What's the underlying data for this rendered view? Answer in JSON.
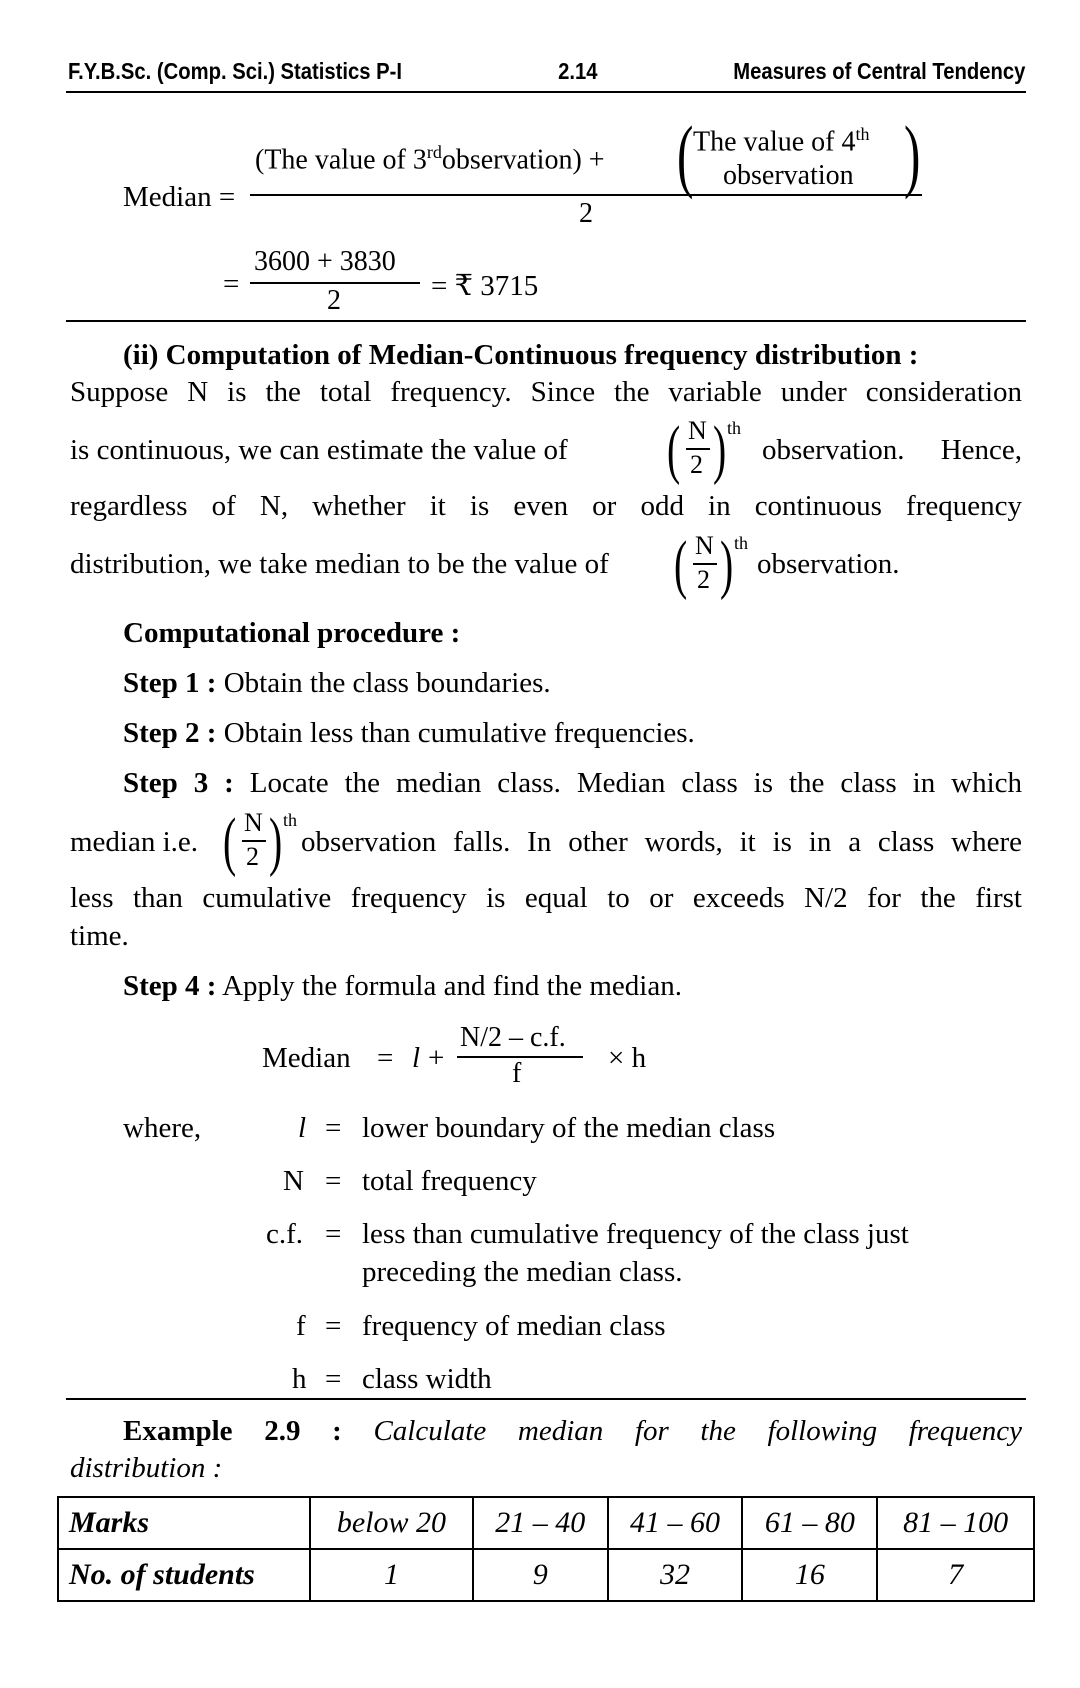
{
  "header": {
    "left": "F.Y.B.Sc. (Comp. Sci.) Statistics P-I",
    "center": "2.14",
    "right": "Measures of Central Tendency"
  },
  "median_formula": {
    "label": "Median =",
    "numerator_left": "(The value of 3",
    "numerator_sup": "rd",
    "numerator_left_end": "observation) +",
    "paren_top": "The value of 4",
    "paren_top_sup": "th",
    "paren_bottom": "observation",
    "denominator": "2",
    "eq2_sign": "=",
    "eq2_numerator": "3600 + 3830",
    "eq2_denominator": "2",
    "eq2_result": "= ₹ 3715"
  },
  "section": {
    "heading": "(ii) Computation of Median-Continuous frequency distribution :",
    "line1": "Suppose N is the total frequency. Since the variable under consideration",
    "line2a": "is continuous, we can estimate the value of",
    "line2b": "observation. Hence,",
    "line3": "regardless of N, whether it is even or odd in continuous frequency",
    "line4a": "distribution, we take median to be the value of",
    "line4b": "observation.",
    "frac_num": "N",
    "frac_den": "2",
    "frac_sup": "th"
  },
  "procedure": {
    "heading": "Computational procedure :",
    "step1_label": "Step 1 :",
    "step1_text": "Obtain the class boundaries.",
    "step2_label": "Step 2 :",
    "step2_text": "Obtain less than cumulative frequencies.",
    "step3_label": "Step 3 :",
    "step3_text": "Locate the median class. Median class is the class in which",
    "step3_line2a": "median i.e.",
    "step3_line2b": "observation falls. In other words, it is in a class where",
    "step3_line3": "less than cumulative frequency is equal to or exceeds N/2 for the first",
    "step3_line4": "time.",
    "step4_label": "Step 4 :",
    "step4_text": "Apply the formula and find the median."
  },
  "formula2": {
    "label": "Median",
    "eq": "=",
    "l": "l",
    "plus": "+",
    "numerator": "N/2 – c.f.",
    "denominator": "f",
    "times": "× h"
  },
  "where": {
    "label": "where,",
    "items": [
      {
        "sym": "l",
        "eq": "=",
        "desc": "lower boundary of the median class"
      },
      {
        "sym": "N",
        "eq": "=",
        "desc": "total frequency"
      },
      {
        "sym": "c.f.",
        "eq": "=",
        "desc": "less than cumulative frequency of the class just",
        "desc2": "preceding the median class."
      },
      {
        "sym": "f",
        "eq": "=",
        "desc": "frequency of median class"
      },
      {
        "sym": "h",
        "eq": "=",
        "desc": "class width"
      }
    ]
  },
  "example": {
    "label": "Example 2.9 :",
    "text": "Calculate median for the following frequency",
    "text2": "distribution :",
    "table": {
      "row1": [
        "Marks",
        "below 20",
        "21 – 40",
        "41 – 60",
        "61 – 80",
        "81 – 100"
      ],
      "row2": [
        "No. of students",
        "1",
        "9",
        "32",
        "16",
        "7"
      ]
    }
  }
}
